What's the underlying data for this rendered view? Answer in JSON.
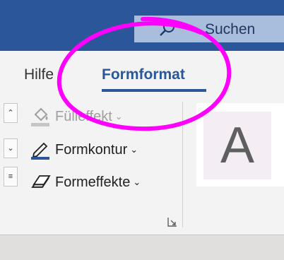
{
  "search": {
    "placeholder": "Suchen"
  },
  "tabs": [
    {
      "label": "Hilfe"
    },
    {
      "label": "Formformat",
      "active": true
    }
  ],
  "ribbon": {
    "commands": [
      {
        "label": "Fülleffekt",
        "enabled": false,
        "icon": "paint-bucket-icon"
      },
      {
        "label": "Formkontur",
        "enabled": true,
        "icon": "pen-icon"
      },
      {
        "label": "Formeffekte",
        "enabled": true,
        "icon": "effects-icon"
      }
    ],
    "preview_letter": "A"
  },
  "colors": {
    "accent": "#2b579a",
    "annotation": "#ff00ff"
  }
}
